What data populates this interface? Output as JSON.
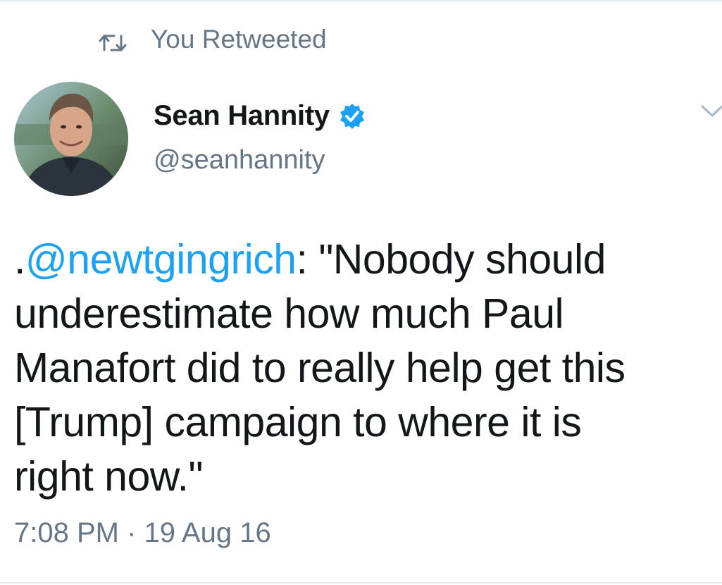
{
  "retweet_context": {
    "icon": "retweet-icon",
    "label": "You Retweeted"
  },
  "author": {
    "avatar_icon": "profile-photo",
    "display_name": "Sean Hannity",
    "verified_icon": "verified-badge-icon",
    "handle": "@seanhannity"
  },
  "menu": {
    "icon": "chevron-down-icon"
  },
  "tweet": {
    "prefix": ".",
    "mention": "@newtgingrich",
    "line1_rest": ": \"Nobody should",
    "line2": "underestimate how much Paul",
    "line3": "Manafort did to really help get this",
    "line4": "[Trump] campaign to where it is",
    "line5": "right now.\""
  },
  "timestamp": "7:08 PM · 19 Aug 16",
  "colors": {
    "link": "#1da1f2",
    "secondary_text": "#657786",
    "primary_text": "#14171a",
    "divider": "#e6ecf0"
  }
}
